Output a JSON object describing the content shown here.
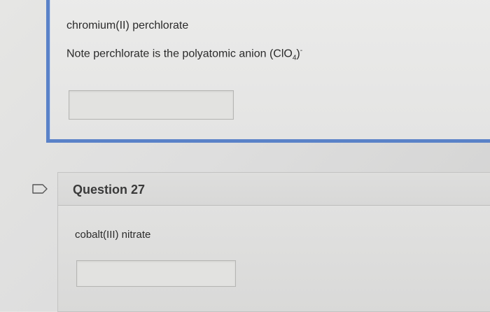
{
  "previous_question": {
    "text": "chromium(II) perchlorate",
    "note_prefix": "Note perchlorate is the polyatomic anion (ClO",
    "note_subscript": "4",
    "note_close": ")",
    "note_superscript": "-",
    "answer_value": ""
  },
  "next_question": {
    "flag_icon": "flag-outline-icon",
    "title": "Question 27",
    "text": "cobalt(III) nitrate",
    "answer_value": ""
  },
  "colors": {
    "accent_border": "#5a82c8"
  }
}
